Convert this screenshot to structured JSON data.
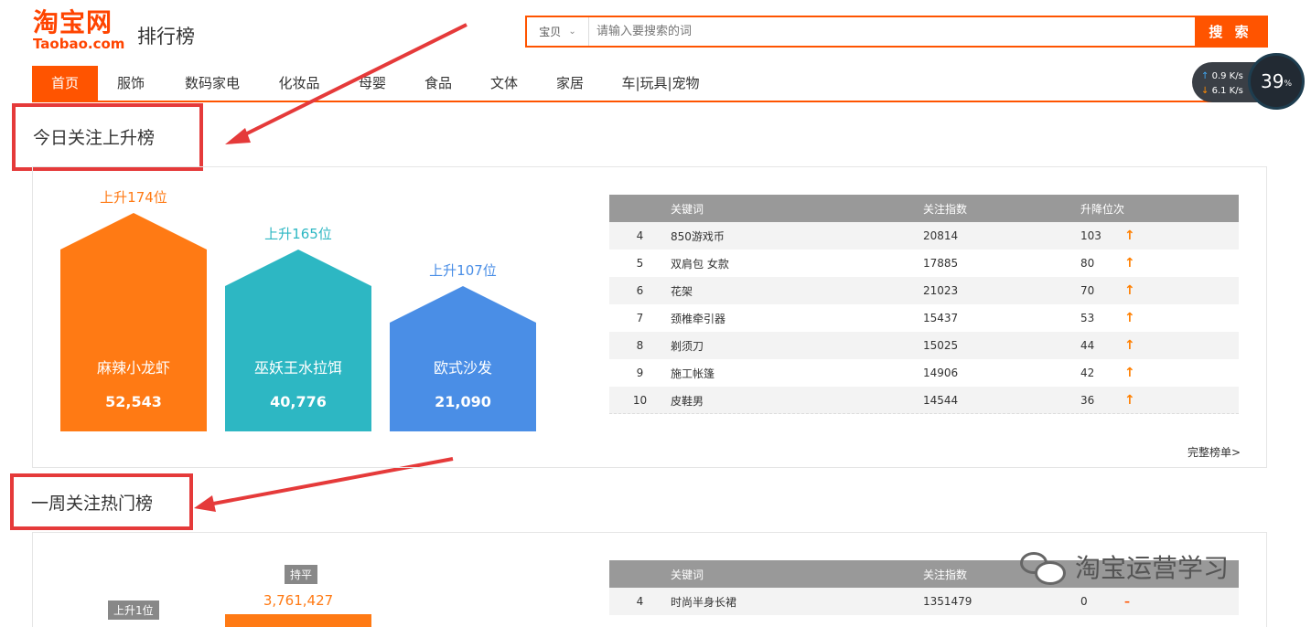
{
  "header": {
    "logo_cn": "淘宝网",
    "logo_en": "Taobao.com",
    "subtitle": "排行榜",
    "search_type": "宝贝",
    "search_placeholder": "请输入要搜索的词",
    "search_button": "搜 索"
  },
  "nav": [
    "首页",
    "服饰",
    "数码家电",
    "化妆品",
    "母婴",
    "食品",
    "文体",
    "家居",
    "车|玩具|宠物"
  ],
  "netmon": {
    "up": "0.9 K/s",
    "down": "6.1 K/s",
    "percent": "39",
    "percent_unit": "%"
  },
  "section1": {
    "title": "今日关注上升榜",
    "houses": [
      {
        "rise": "上升174位",
        "name": "麻辣小龙虾",
        "value": "52,543",
        "color": "#ff7a14"
      },
      {
        "rise": "上升165位",
        "name": "巫妖王水拉饵",
        "value": "40,776",
        "color": "#2db7c3"
      },
      {
        "rise": "上升107位",
        "name": "欧式沙发",
        "value": "21,090",
        "color": "#4a8ee6"
      }
    ],
    "table": {
      "headers": [
        "",
        "关键词",
        "关注指数",
        "升降位次"
      ],
      "rows": [
        {
          "rank": "4",
          "keyword": "850游戏币",
          "index": "20814",
          "change": "103"
        },
        {
          "rank": "5",
          "keyword": "双肩包 女款",
          "index": "17885",
          "change": "80"
        },
        {
          "rank": "6",
          "keyword": "花架",
          "index": "21023",
          "change": "70"
        },
        {
          "rank": "7",
          "keyword": "颈椎牵引器",
          "index": "15437",
          "change": "53"
        },
        {
          "rank": "8",
          "keyword": "剃须刀",
          "index": "15025",
          "change": "44"
        },
        {
          "rank": "9",
          "keyword": "施工帐篷",
          "index": "14906",
          "change": "42"
        },
        {
          "rank": "10",
          "keyword": "皮鞋男",
          "index": "14544",
          "change": "36"
        }
      ]
    },
    "full_link": "完整榜单>"
  },
  "section2": {
    "title": "一周关注热门榜",
    "tag_flat": "持平",
    "tag_rise": "上升1位",
    "top_value": "3,761,427",
    "table": {
      "headers": [
        "",
        "关键词",
        "关注指数",
        ""
      ],
      "rows": [
        {
          "rank": "4",
          "keyword": "时尚半身长裙",
          "index": "1351479",
          "change": "0"
        }
      ]
    }
  },
  "watermark": "淘宝运营学习",
  "colors": {
    "brand": "#ff5400",
    "annotation": "#e53a3a"
  }
}
